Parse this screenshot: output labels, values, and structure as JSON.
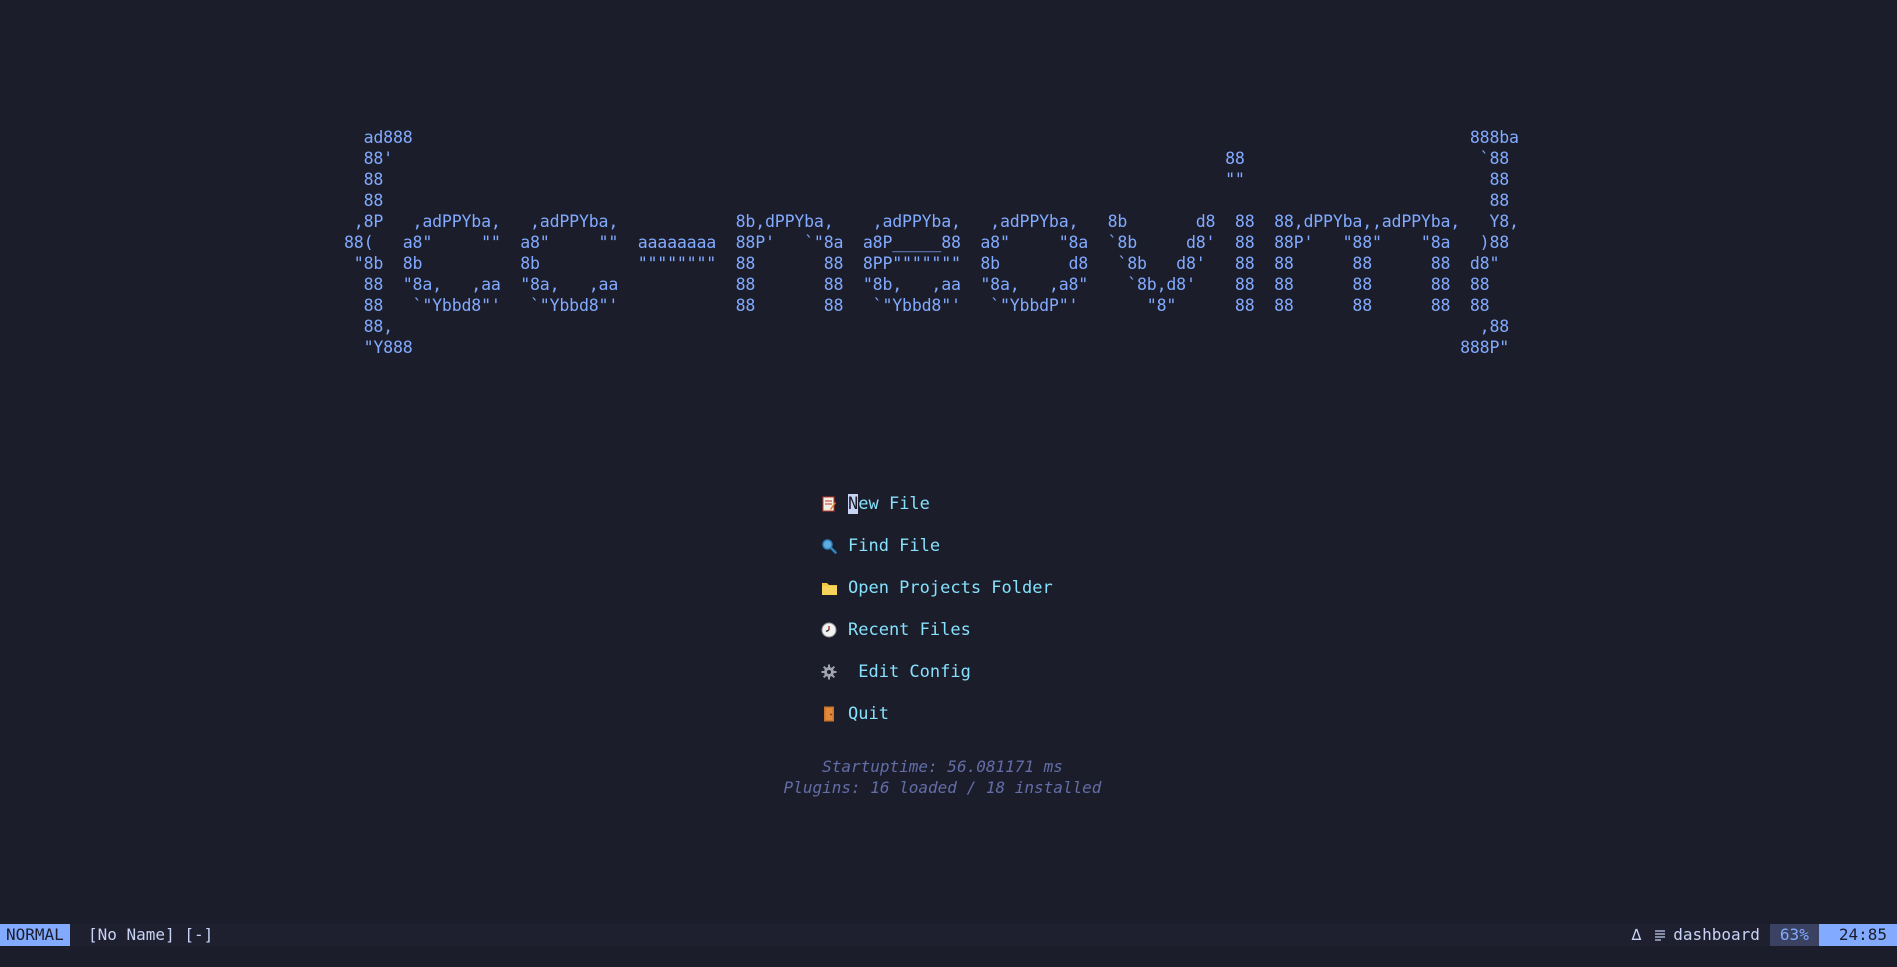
{
  "colors": {
    "background": "#1b1d2b",
    "banner": "#82aaff",
    "menu_text": "#86e1fc",
    "footer_text": "#636da6",
    "mode_bg": "#82aaff",
    "statusline_bg": "#1e2030"
  },
  "banner": {
    "ascii_art": "  ad888                                                                                                            888ba\n  88'                                                                                     88                        `88\n  88                                                                                      \"\"                         88\n  88                                                                                                                 88\n ,8P   ,adPPYba,   ,adPPYba,            8b,dPPYba,    ,adPPYba,   ,adPPYba,   8b       d8  88  88,dPPYba,,adPPYba,   Y8,\n88(   a8\"     \"\"  a8\"     \"\"  aaaaaaaa  88P'   `\"8a  a8P_____88  a8\"     \"8a  `8b     d8'  88  88P'   \"88\"    \"8a   )88\n \"8b  8b          8b          \"\"\"\"\"\"\"\"  88       88  8PP\"\"\"\"\"\"\"  8b       d8   `8b   d8'   88  88      88      88  d8\"\n  88  \"8a,   ,aa  \"8a,   ,aa            88       88  \"8b,   ,aa  \"8a,   ,a8\"    `8b,d8'    88  88      88      88  88\n  88   `\"Ybbd8\"'   `\"Ybbd8\"'            88       88   `\"Ybbd8\"'   `\"YbbdP\"'       \"8\"      88  88      88      88  88\n  88,                                                                                                               ,88\n  \"Y888                                                                                                           888P\""
  },
  "menu": {
    "items": [
      {
        "icon": "new-file-icon",
        "label": "New File",
        "cursor": true
      },
      {
        "icon": "find-file-icon",
        "label": "Find File"
      },
      {
        "icon": "folder-icon",
        "label": "Open Projects Folder"
      },
      {
        "icon": "recent-files-icon",
        "label": "Recent Files"
      },
      {
        "icon": "gear-icon",
        "label": " Edit Config"
      },
      {
        "icon": "door-icon",
        "label": "Quit"
      }
    ],
    "new_file_first": "N",
    "new_file_rest": "ew File",
    "find_file": "Find File",
    "open_projects": "Open Projects Folder",
    "recent_files": "Recent Files",
    "edit_config": " Edit Config",
    "quit": "Quit"
  },
  "footer": {
    "startuptime": "Startuptime: 56.081171 ms",
    "plugins": "Plugins: 16 loaded / 18 installed"
  },
  "statusline": {
    "mode": "NORMAL",
    "filename": "[No Name] [-]",
    "branch_icon": "∆",
    "filetype_icon": "lines-icon",
    "filetype": "dashboard",
    "percent": "63%",
    "position": "24:85"
  }
}
